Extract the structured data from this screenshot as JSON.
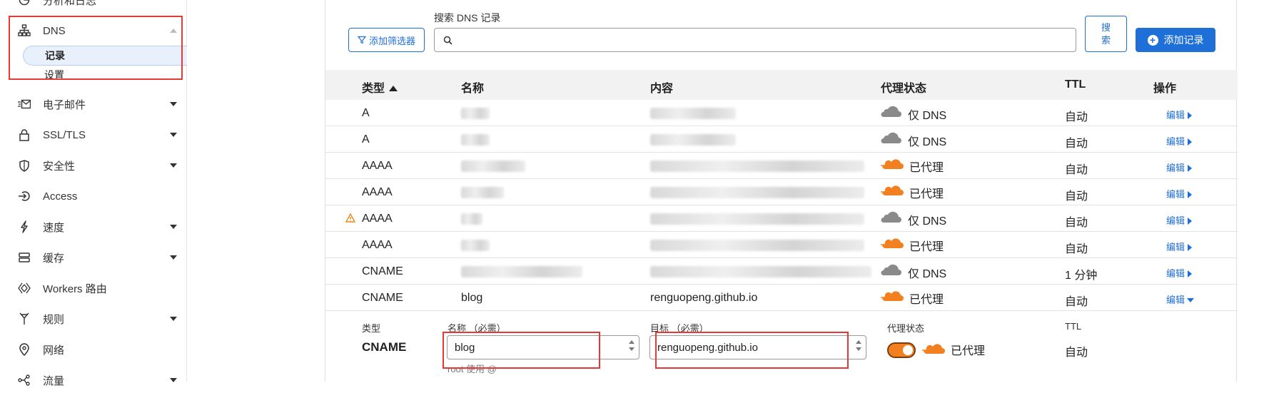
{
  "sidebar": {
    "top_item": "分析和日志",
    "dns": "DNS",
    "dns_sub": [
      "记录",
      "设置"
    ],
    "items": [
      {
        "label": "电子邮件",
        "caret": true,
        "icon": "email-routing-icon"
      },
      {
        "label": "SSL/TLS",
        "caret": true,
        "icon": "lock-icon"
      },
      {
        "label": "安全性",
        "caret": true,
        "icon": "shield-icon"
      },
      {
        "label": "Access",
        "caret": false,
        "icon": "access-icon"
      },
      {
        "label": "速度",
        "caret": true,
        "icon": "lightning-icon"
      },
      {
        "label": "缓存",
        "caret": true,
        "icon": "cache-icon"
      },
      {
        "label": "Workers 路由",
        "caret": false,
        "icon": "workers-icon"
      },
      {
        "label": "规则",
        "caret": true,
        "icon": "rules-icon"
      },
      {
        "label": "网络",
        "caret": false,
        "icon": "location-pin-icon"
      },
      {
        "label": "流量",
        "caret": true,
        "icon": "traffic-icon"
      }
    ]
  },
  "toolbar": {
    "filter": "添加筛选器",
    "search_label": "搜索 DNS 记录",
    "search_value": "",
    "search_btn": "搜索",
    "add": "添加记录"
  },
  "table": {
    "headers": {
      "type": "类型",
      "name": "名称",
      "content": "内容",
      "proxy": "代理状态",
      "ttl": "TTL",
      "action": "操作"
    },
    "rows": [
      {
        "type": "A",
        "name": "",
        "content": "",
        "proxy": "仅 DNS",
        "proxied": false,
        "ttl": "自动",
        "edit": "编辑",
        "warn": false
      },
      {
        "type": "A",
        "name": "",
        "content": "",
        "proxy": "仅 DNS",
        "proxied": false,
        "ttl": "自动",
        "edit": "编辑",
        "warn": false
      },
      {
        "type": "AAAA",
        "name": "",
        "content": "",
        "proxy": "已代理",
        "proxied": true,
        "ttl": "自动",
        "edit": "编辑",
        "warn": false
      },
      {
        "type": "AAAA",
        "name": "",
        "content": "",
        "proxy": "已代理",
        "proxied": true,
        "ttl": "自动",
        "edit": "编辑",
        "warn": false
      },
      {
        "type": "AAAA",
        "name": "",
        "content": "",
        "proxy": "仅 DNS",
        "proxied": false,
        "ttl": "自动",
        "edit": "编辑",
        "warn": true
      },
      {
        "type": "AAAA",
        "name": "",
        "content": "",
        "proxy": "已代理",
        "proxied": true,
        "ttl": "自动",
        "edit": "编辑",
        "warn": false
      },
      {
        "type": "CNAME",
        "name": "",
        "content": "",
        "proxy": "仅 DNS",
        "proxied": false,
        "ttl": "1 分钟",
        "edit": "编辑",
        "warn": false
      },
      {
        "type": "CNAME",
        "name": "blog",
        "content": "renguopeng.github.io",
        "proxy": "已代理",
        "proxied": true,
        "ttl": "自动",
        "edit": "编辑",
        "warn": false
      }
    ]
  },
  "edit_form": {
    "type_label": "类型",
    "type_value": "CNAME",
    "name_label": "名称 （必需）",
    "name_value": "blog",
    "name_hint": "root 使用 @",
    "target_label": "目标 （必需）",
    "target_value": "renguopeng.github.io",
    "proxy_label": "代理状态",
    "proxy_value": "已代理",
    "ttl_label": "TTL",
    "ttl_value": "自动"
  },
  "colors": {
    "accent": "#1f6fd8",
    "proxied_cloud": "#f38020",
    "dns_cloud": "#8a8a8a",
    "highlight": "#e53935"
  }
}
